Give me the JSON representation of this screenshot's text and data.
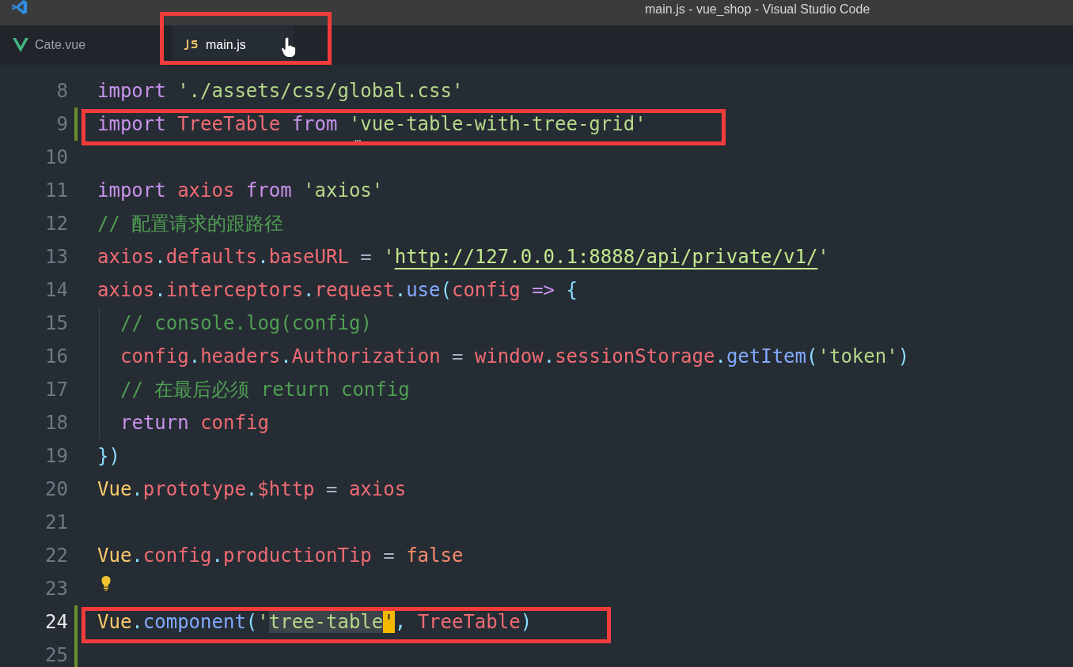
{
  "window": {
    "title": "main.js - vue_shop - Visual Studio Code"
  },
  "tabs": [
    {
      "label": "Cate.vue",
      "kind": "vue",
      "selected": false,
      "boxed": false
    },
    {
      "label": "main.js",
      "kind": "js",
      "selected": true,
      "boxed": true
    }
  ],
  "lines": [
    {
      "number": "8",
      "current": false,
      "modified": false,
      "boxed": false,
      "tokens": [
        {
          "kind": "kw",
          "t": "import "
        },
        {
          "kind": "str",
          "t": "'./assets/css/global.css'"
        }
      ]
    },
    {
      "number": "9",
      "current": false,
      "modified": true,
      "boxed": true,
      "hint": "…",
      "tokens": [
        {
          "kind": "kw",
          "t": "import "
        },
        {
          "kind": "var",
          "t": "TreeTable "
        },
        {
          "kind": "kw",
          "t": "from "
        },
        {
          "kind": "str",
          "t": "'vue-table-with-tree-grid'"
        }
      ]
    },
    {
      "number": "10",
      "current": false,
      "modified": false,
      "boxed": false
    },
    {
      "number": "11",
      "current": false,
      "modified": false,
      "boxed": false,
      "tokens": [
        {
          "kind": "kw",
          "t": "import "
        },
        {
          "kind": "var",
          "t": "axios "
        },
        {
          "kind": "kw",
          "t": "from "
        },
        {
          "kind": "str",
          "t": "'axios'"
        }
      ]
    },
    {
      "number": "12",
      "current": false,
      "modified": false,
      "boxed": false,
      "tokens": [
        {
          "kind": "cmt",
          "t": "// 配置请求的跟路径"
        }
      ]
    },
    {
      "number": "13",
      "current": false,
      "modified": false,
      "boxed": false,
      "tokens": [
        {
          "kind": "var",
          "t": "axios"
        },
        {
          "kind": "pun",
          "t": "."
        },
        {
          "kind": "var",
          "t": "defaults"
        },
        {
          "kind": "pun",
          "t": "."
        },
        {
          "kind": "var",
          "t": "baseURL "
        },
        {
          "kind": "op",
          "t": "= "
        },
        {
          "kind": "str",
          "t": "'"
        },
        {
          "kind": "link",
          "t": "http://127.0.0.1:8888/api/private/v1/"
        },
        {
          "kind": "str",
          "t": "'"
        }
      ]
    },
    {
      "number": "14",
      "current": false,
      "modified": false,
      "boxed": false,
      "tokens": [
        {
          "kind": "var",
          "t": "axios"
        },
        {
          "kind": "pun",
          "t": "."
        },
        {
          "kind": "var",
          "t": "interceptors"
        },
        {
          "kind": "pun",
          "t": "."
        },
        {
          "kind": "var",
          "t": "request"
        },
        {
          "kind": "pun",
          "t": "."
        },
        {
          "kind": "fn",
          "t": "use"
        },
        {
          "kind": "pun",
          "t": "("
        },
        {
          "kind": "var",
          "t": "config "
        },
        {
          "kind": "kw",
          "t": "=> "
        },
        {
          "kind": "pun",
          "t": "{"
        }
      ]
    },
    {
      "number": "15",
      "current": false,
      "modified": false,
      "boxed": false,
      "indent": true,
      "tokens": [
        {
          "kind": "cmt",
          "t": "// console.log(config)"
        }
      ]
    },
    {
      "number": "16",
      "current": false,
      "modified": false,
      "boxed": false,
      "indent": true,
      "tokens": [
        {
          "kind": "var",
          "t": "config"
        },
        {
          "kind": "pun",
          "t": "."
        },
        {
          "kind": "var",
          "t": "headers"
        },
        {
          "kind": "pun",
          "t": "."
        },
        {
          "kind": "var",
          "t": "Authorization "
        },
        {
          "kind": "op",
          "t": "= "
        },
        {
          "kind": "var",
          "t": "window"
        },
        {
          "kind": "pun",
          "t": "."
        },
        {
          "kind": "var",
          "t": "sessionStorage"
        },
        {
          "kind": "pun",
          "t": "."
        },
        {
          "kind": "fn",
          "t": "getItem"
        },
        {
          "kind": "pun",
          "t": "("
        },
        {
          "kind": "str",
          "t": "'token'"
        },
        {
          "kind": "pun",
          "t": ")"
        }
      ]
    },
    {
      "number": "17",
      "current": false,
      "modified": false,
      "boxed": false,
      "indent": true,
      "tokens": [
        {
          "kind": "cmt",
          "t": "// 在最后必须 return config"
        }
      ]
    },
    {
      "number": "18",
      "current": false,
      "modified": false,
      "boxed": false,
      "indent": true,
      "tokens": [
        {
          "kind": "kw",
          "t": "return "
        },
        {
          "kind": "var",
          "t": "config"
        }
      ]
    },
    {
      "number": "19",
      "current": false,
      "modified": false,
      "boxed": false,
      "tokens": [
        {
          "kind": "pun",
          "t": "})"
        }
      ]
    },
    {
      "number": "20",
      "current": false,
      "modified": false,
      "boxed": false,
      "tokens": [
        {
          "kind": "cls",
          "t": "Vue"
        },
        {
          "kind": "pun",
          "t": "."
        },
        {
          "kind": "var",
          "t": "prototype"
        },
        {
          "kind": "pun",
          "t": "."
        },
        {
          "kind": "var",
          "t": "$http "
        },
        {
          "kind": "op",
          "t": "= "
        },
        {
          "kind": "var",
          "t": "axios"
        }
      ]
    },
    {
      "number": "21",
      "current": false,
      "modified": false,
      "boxed": false
    },
    {
      "number": "22",
      "current": false,
      "modified": false,
      "boxed": false,
      "tokens": [
        {
          "kind": "cls",
          "t": "Vue"
        },
        {
          "kind": "pun",
          "t": "."
        },
        {
          "kind": "var",
          "t": "config"
        },
        {
          "kind": "pun",
          "t": "."
        },
        {
          "kind": "var",
          "t": "productionTip "
        },
        {
          "kind": "op",
          "t": "= "
        },
        {
          "kind": "bool",
          "t": "false"
        }
      ]
    },
    {
      "number": "23",
      "current": false,
      "modified": false,
      "boxed": false,
      "lightbulb": true
    },
    {
      "number": "24",
      "current": true,
      "modified": true,
      "boxed": true,
      "tokens": [
        {
          "kind": "cls",
          "t": "Vue"
        },
        {
          "kind": "pun",
          "t": "."
        },
        {
          "kind": "fn",
          "t": "component"
        },
        {
          "kind": "pun",
          "t": "("
        },
        {
          "kind": "str",
          "t": "'"
        },
        {
          "kind": "sel",
          "t": "tree-table"
        },
        {
          "kind": "cursor",
          "t": "'"
        },
        {
          "kind": "pun",
          "t": ", "
        },
        {
          "kind": "var",
          "t": "TreeTable"
        },
        {
          "kind": "pun",
          "t": ")"
        }
      ]
    },
    {
      "number": "25",
      "current": false,
      "modified": true,
      "boxed": false
    }
  ]
}
